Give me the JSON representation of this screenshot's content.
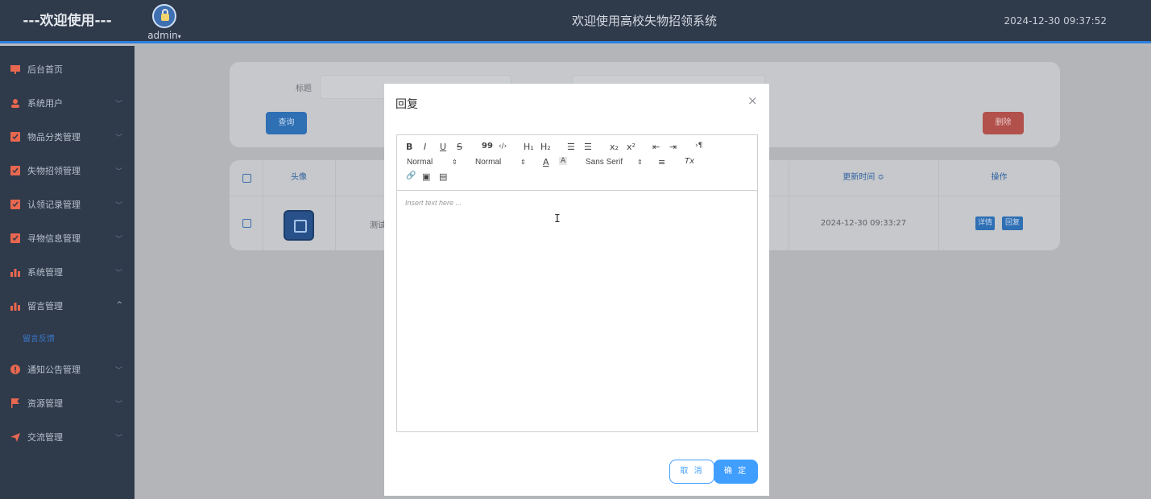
{
  "header": {
    "brand": "---欢迎使用---",
    "user": "admin",
    "user_caret": "▾",
    "title": "欢迎使用高校失物招领系统",
    "datetime": "2024-12-30 09:37:52"
  },
  "sidebar": {
    "items": [
      {
        "label": "后台首页",
        "icon": "monitor-icon",
        "color": "#e8674f"
      },
      {
        "label": "系统用户",
        "icon": "user-icon",
        "color": "#e8674f"
      },
      {
        "label": "物品分类管理",
        "icon": "checkbox-icon",
        "color": "#e8674f"
      },
      {
        "label": "失物招领管理",
        "icon": "checkbox-icon",
        "color": "#e8674f"
      },
      {
        "label": "认领记录管理",
        "icon": "checkbox-icon",
        "color": "#e8674f"
      },
      {
        "label": "寻物信息管理",
        "icon": "checkbox-icon",
        "color": "#e8674f"
      },
      {
        "label": "系统管理",
        "icon": "bar-chart-icon",
        "color": "#e8674f"
      },
      {
        "label": "留言管理",
        "icon": "bar-chart-icon",
        "color": "#e8674f"
      },
      {
        "label": "通知公告管理",
        "icon": "alert-icon",
        "color": "#e8674f"
      },
      {
        "label": "资源管理",
        "icon": "flag-icon",
        "color": "#e8674f"
      },
      {
        "label": "交流管理",
        "icon": "send-icon",
        "color": "#e8674f"
      }
    ],
    "sub_item": "留言反馈",
    "chevron_down": "﹀",
    "chevron_up": "^"
  },
  "search": {
    "title_label": "标题",
    "query_button": "查询",
    "delete_button": "删除"
  },
  "table": {
    "headers": {
      "avatar": "头像",
      "updated": "更新时间 ≎",
      "actions": "操作"
    },
    "row": {
      "name_partial": "测试",
      "updated": "2024-12-30 09:33:27",
      "detail_button": "详情",
      "reply_button": "回复"
    }
  },
  "modal": {
    "title": "回复",
    "close": "×",
    "toolbar": {
      "bold": "B",
      "italic": "I",
      "underline": "U",
      "strike": "S",
      "quote": "99",
      "code": "‹/›",
      "h1": "H₁",
      "h2": "H₂",
      "ordered_list": "☰",
      "bullet_list": "☰",
      "sub": "x₂",
      "sup": "x²",
      "outdent": "⇤",
      "indent": "⇥",
      "direction": "›¶",
      "size1": "Normal",
      "size2": "Normal",
      "color": "A",
      "background": "A",
      "font": "Sans Serif",
      "align": "≡",
      "clean": "Tx",
      "link": "🔗",
      "image": "▣",
      "video": "▤",
      "caret": "⇕"
    },
    "placeholder": "Insert text here ...",
    "cancel": "取 消",
    "confirm": "确 定"
  },
  "colors": {
    "primary": "#409eff",
    "sidebar": "#2f3a4b",
    "accent_bar": "#2d7fe0",
    "danger": "#f56c6c"
  }
}
